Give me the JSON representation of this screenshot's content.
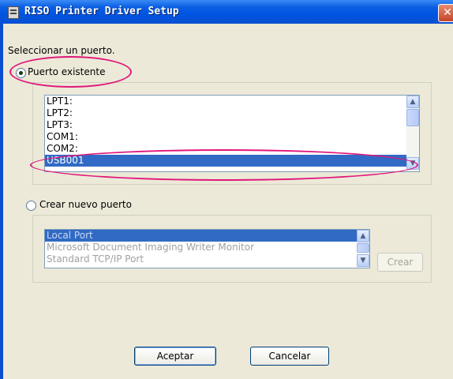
{
  "window": {
    "title": "RISO Printer Driver Setup",
    "close_glyph": "✕"
  },
  "prompt": "Seleccionar un puerto.",
  "existing": {
    "label": "Puerto existente",
    "checked": true,
    "ports": [
      "LPT1:",
      "LPT2:",
      "LPT3:",
      "COM1:",
      "COM2:",
      "USB001"
    ],
    "selected": "USB001"
  },
  "create_new": {
    "label": "Crear nuevo puerto",
    "checked": false,
    "port_types": [
      "Local Port",
      "Microsoft Document Imaging Writer Monitor",
      "Standard TCP/IP Port"
    ],
    "selected": "Local Port",
    "create_label": "Crear"
  },
  "buttons": {
    "ok": "Aceptar",
    "cancel": "Cancelar"
  },
  "annotation_color": "#e0177a",
  "selection_color": "#316ac5"
}
